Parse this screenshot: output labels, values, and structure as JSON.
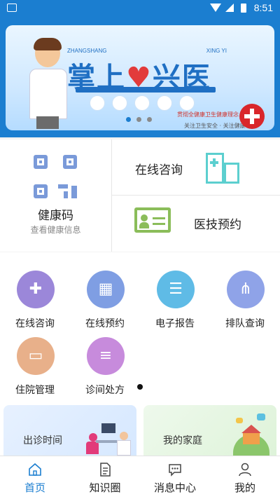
{
  "status_bar": {
    "time": "8:51"
  },
  "banner": {
    "title_left": "掌上",
    "title_right": "兴医",
    "sub_left": "ZHANGSHANG",
    "sub_right": "XING YI",
    "promo_line1": "贯彻全健康卫生健康理念",
    "promo_line2": "关注卫生安全 · 关注健康"
  },
  "quick_access": {
    "health_code": {
      "title": "健康码",
      "subtitle": "查看健康信息"
    },
    "online_consult": {
      "label": "在线咨询"
    },
    "tech_booking": {
      "label": "医技预约"
    }
  },
  "services": [
    {
      "label": "在线咨询",
      "icon": "chat-plus-icon",
      "color": "#9b87d9"
    },
    {
      "label": "在线预约",
      "icon": "hospital-icon",
      "color": "#7f9ee3"
    },
    {
      "label": "电子报告",
      "icon": "report-icon",
      "color": "#5fbbe6"
    },
    {
      "label": "排队查询",
      "icon": "share-nodes-icon",
      "color": "#8fa3e8"
    },
    {
      "label": "住院管理",
      "icon": "bed-icon",
      "color": "#e8b08a"
    },
    {
      "label": "诊间处方",
      "icon": "prescription-icon",
      "color": "#c78bdc"
    }
  ],
  "cards": {
    "schedule": "出诊时间",
    "family": "我的家庭"
  },
  "tabs": [
    {
      "label": "首页",
      "icon": "home-icon",
      "active": true
    },
    {
      "label": "知识圈",
      "icon": "document-icon",
      "active": false
    },
    {
      "label": "消息中心",
      "icon": "message-icon",
      "active": false
    },
    {
      "label": "我的",
      "icon": "user-icon",
      "active": false
    }
  ]
}
